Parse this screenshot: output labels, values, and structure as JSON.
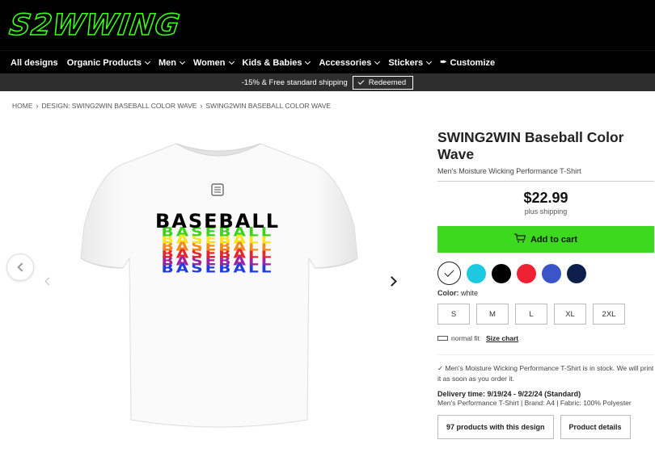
{
  "logo": {
    "text": "S2WWING"
  },
  "nav": {
    "items": [
      {
        "label": "All designs",
        "dropdown": false
      },
      {
        "label": "Organic Products",
        "dropdown": true
      },
      {
        "label": "Men",
        "dropdown": true
      },
      {
        "label": "Women",
        "dropdown": true
      },
      {
        "label": "Kids & Babies",
        "dropdown": true
      },
      {
        "label": "Accessories",
        "dropdown": true
      },
      {
        "label": "Stickers",
        "dropdown": true
      }
    ],
    "customize_label": "Customize"
  },
  "promo": {
    "text": "-15% & Free standard shipping",
    "redeemed_label": "Redeemed"
  },
  "breadcrumb": [
    "HOME",
    "DESIGN: SWING2WIN BASEBALL COLOR WAVE",
    "SWING2WIN BASEBALL COLOR WAVE"
  ],
  "product": {
    "title": "SWING2WIN Baseball Color Wave",
    "subtitle": "Men's Moisture Wicking Performance T-Shirt",
    "price": "$22.99",
    "shipping": "plus shipping",
    "add_to_cart": "Add to cart",
    "shirt_text": "BASEBALL",
    "colors": [
      "#ffffff",
      "#1ec8e0",
      "#000000",
      "#ee2233",
      "#3a55c8",
      "#0e1e4a"
    ],
    "color_label": "Color:",
    "color_value": "white",
    "sizes": [
      "S",
      "M",
      "L",
      "XL",
      "2XL"
    ],
    "fit": "normal fit",
    "size_chart": "Size chart",
    "stock_text": "Men's Moisture Wicking Performance T-Shirt is in stock. We will print it as soon as you order it.",
    "delivery": "Delivery time: 9/19/24 - 9/22/24 (Standard)",
    "delivery_sub": "Men's Performance T-Shirt | Brand: A4 | Fabric: 100% Polyester",
    "products_button": "97 products with this design",
    "details_button": "Product details"
  },
  "wave_colors": [
    "#000000",
    "#3cd21e",
    "#f7e61c",
    "#f28a1e",
    "#e6262c",
    "#a0239c",
    "#1e3ce0"
  ]
}
